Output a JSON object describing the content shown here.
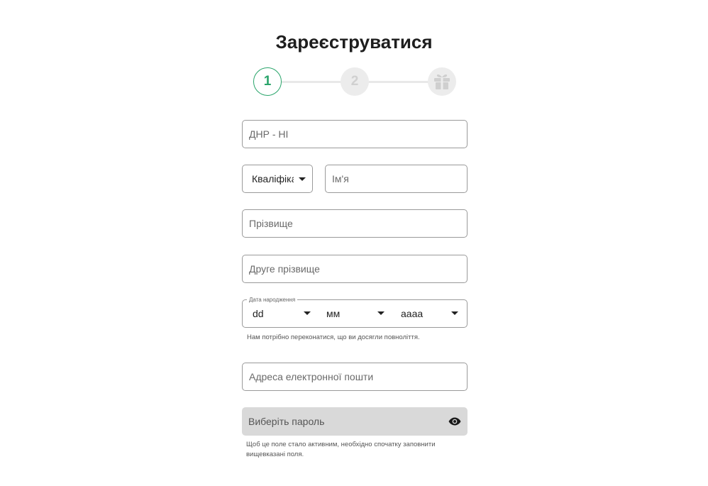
{
  "title": "Зареєструватися",
  "stepper": {
    "step1": "1",
    "step2": "2",
    "step3_icon": "gift-icon",
    "active_color": "#2aa56b"
  },
  "form": {
    "dni_placeholder": "ДНР - НІ",
    "title_select_value": "Кваліфікація",
    "name_placeholder": "Ім'я",
    "surname_placeholder": "Прізвище",
    "second_surname_placeholder": "Друге прізвище",
    "dob": {
      "legend": "Дата народження",
      "day": "dd",
      "month": "мм",
      "year": "аааа",
      "hint": "Нам потрібно переконатися, що ви досягли повноліття."
    },
    "email_placeholder": "Адреса електронної пошти",
    "password_placeholder": "Виберіть пароль",
    "password_icon": "eye-icon",
    "password_hint": "Щоб це поле стало активним, необхідно спочатку заповнити вищевказані поля."
  }
}
